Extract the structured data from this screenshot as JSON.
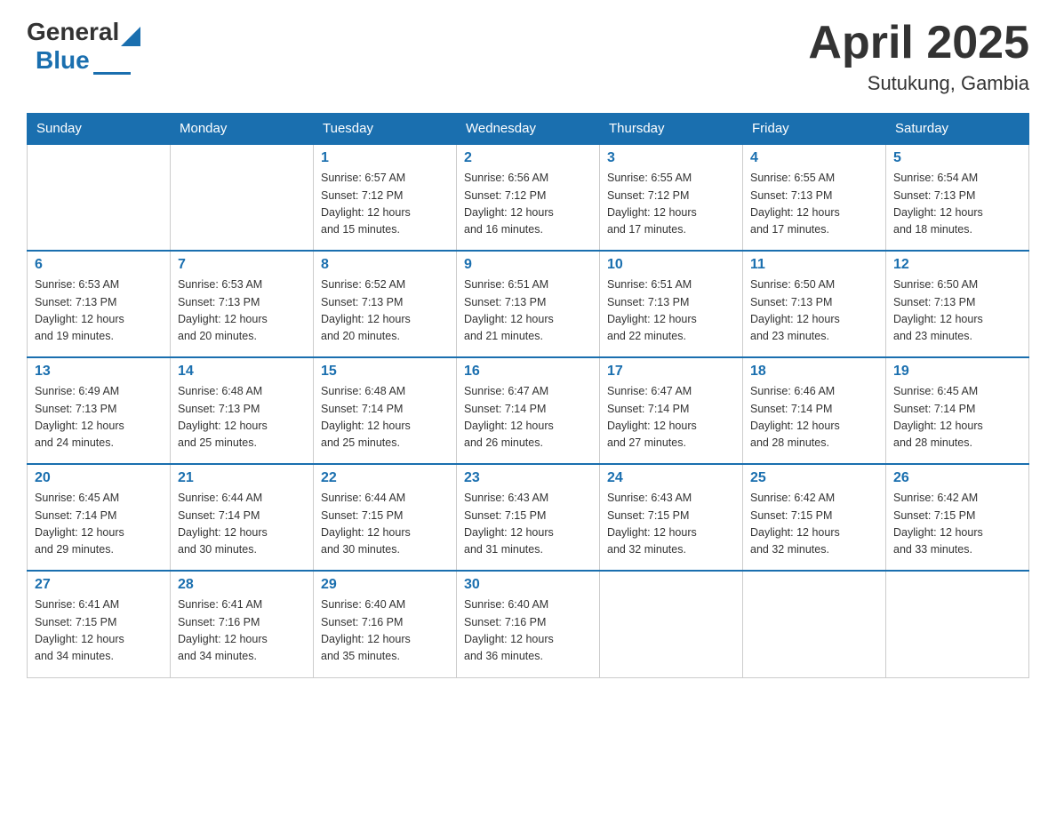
{
  "logo": {
    "text_general": "General",
    "text_blue": "Blue"
  },
  "title": "April 2025",
  "subtitle": "Sutukung, Gambia",
  "weekdays": [
    "Sunday",
    "Monday",
    "Tuesday",
    "Wednesday",
    "Thursday",
    "Friday",
    "Saturday"
  ],
  "weeks": [
    [
      {
        "day": "",
        "info": ""
      },
      {
        "day": "",
        "info": ""
      },
      {
        "day": "1",
        "info": "Sunrise: 6:57 AM\nSunset: 7:12 PM\nDaylight: 12 hours\nand 15 minutes."
      },
      {
        "day": "2",
        "info": "Sunrise: 6:56 AM\nSunset: 7:12 PM\nDaylight: 12 hours\nand 16 minutes."
      },
      {
        "day": "3",
        "info": "Sunrise: 6:55 AM\nSunset: 7:12 PM\nDaylight: 12 hours\nand 17 minutes."
      },
      {
        "day": "4",
        "info": "Sunrise: 6:55 AM\nSunset: 7:13 PM\nDaylight: 12 hours\nand 17 minutes."
      },
      {
        "day": "5",
        "info": "Sunrise: 6:54 AM\nSunset: 7:13 PM\nDaylight: 12 hours\nand 18 minutes."
      }
    ],
    [
      {
        "day": "6",
        "info": "Sunrise: 6:53 AM\nSunset: 7:13 PM\nDaylight: 12 hours\nand 19 minutes."
      },
      {
        "day": "7",
        "info": "Sunrise: 6:53 AM\nSunset: 7:13 PM\nDaylight: 12 hours\nand 20 minutes."
      },
      {
        "day": "8",
        "info": "Sunrise: 6:52 AM\nSunset: 7:13 PM\nDaylight: 12 hours\nand 20 minutes."
      },
      {
        "day": "9",
        "info": "Sunrise: 6:51 AM\nSunset: 7:13 PM\nDaylight: 12 hours\nand 21 minutes."
      },
      {
        "day": "10",
        "info": "Sunrise: 6:51 AM\nSunset: 7:13 PM\nDaylight: 12 hours\nand 22 minutes."
      },
      {
        "day": "11",
        "info": "Sunrise: 6:50 AM\nSunset: 7:13 PM\nDaylight: 12 hours\nand 23 minutes."
      },
      {
        "day": "12",
        "info": "Sunrise: 6:50 AM\nSunset: 7:13 PM\nDaylight: 12 hours\nand 23 minutes."
      }
    ],
    [
      {
        "day": "13",
        "info": "Sunrise: 6:49 AM\nSunset: 7:13 PM\nDaylight: 12 hours\nand 24 minutes."
      },
      {
        "day": "14",
        "info": "Sunrise: 6:48 AM\nSunset: 7:13 PM\nDaylight: 12 hours\nand 25 minutes."
      },
      {
        "day": "15",
        "info": "Sunrise: 6:48 AM\nSunset: 7:14 PM\nDaylight: 12 hours\nand 25 minutes."
      },
      {
        "day": "16",
        "info": "Sunrise: 6:47 AM\nSunset: 7:14 PM\nDaylight: 12 hours\nand 26 minutes."
      },
      {
        "day": "17",
        "info": "Sunrise: 6:47 AM\nSunset: 7:14 PM\nDaylight: 12 hours\nand 27 minutes."
      },
      {
        "day": "18",
        "info": "Sunrise: 6:46 AM\nSunset: 7:14 PM\nDaylight: 12 hours\nand 28 minutes."
      },
      {
        "day": "19",
        "info": "Sunrise: 6:45 AM\nSunset: 7:14 PM\nDaylight: 12 hours\nand 28 minutes."
      }
    ],
    [
      {
        "day": "20",
        "info": "Sunrise: 6:45 AM\nSunset: 7:14 PM\nDaylight: 12 hours\nand 29 minutes."
      },
      {
        "day": "21",
        "info": "Sunrise: 6:44 AM\nSunset: 7:14 PM\nDaylight: 12 hours\nand 30 minutes."
      },
      {
        "day": "22",
        "info": "Sunrise: 6:44 AM\nSunset: 7:15 PM\nDaylight: 12 hours\nand 30 minutes."
      },
      {
        "day": "23",
        "info": "Sunrise: 6:43 AM\nSunset: 7:15 PM\nDaylight: 12 hours\nand 31 minutes."
      },
      {
        "day": "24",
        "info": "Sunrise: 6:43 AM\nSunset: 7:15 PM\nDaylight: 12 hours\nand 32 minutes."
      },
      {
        "day": "25",
        "info": "Sunrise: 6:42 AM\nSunset: 7:15 PM\nDaylight: 12 hours\nand 32 minutes."
      },
      {
        "day": "26",
        "info": "Sunrise: 6:42 AM\nSunset: 7:15 PM\nDaylight: 12 hours\nand 33 minutes."
      }
    ],
    [
      {
        "day": "27",
        "info": "Sunrise: 6:41 AM\nSunset: 7:15 PM\nDaylight: 12 hours\nand 34 minutes."
      },
      {
        "day": "28",
        "info": "Sunrise: 6:41 AM\nSunset: 7:16 PM\nDaylight: 12 hours\nand 34 minutes."
      },
      {
        "day": "29",
        "info": "Sunrise: 6:40 AM\nSunset: 7:16 PM\nDaylight: 12 hours\nand 35 minutes."
      },
      {
        "day": "30",
        "info": "Sunrise: 6:40 AM\nSunset: 7:16 PM\nDaylight: 12 hours\nand 36 minutes."
      },
      {
        "day": "",
        "info": ""
      },
      {
        "day": "",
        "info": ""
      },
      {
        "day": "",
        "info": ""
      }
    ]
  ]
}
